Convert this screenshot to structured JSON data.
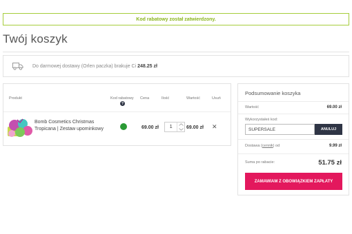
{
  "alert": {
    "message": "Kod rabatowy został zatwierdzony."
  },
  "page": {
    "title": "Twój koszyk"
  },
  "shipping": {
    "icon": "truck-icon",
    "text": "Do darmowej dostawy (Orlen paczka) brakuje Ci",
    "amount": "248.25 zł"
  },
  "cart": {
    "headers": {
      "product": "Produkt",
      "discount_code": "Kod rabatowy",
      "discount_icon": "?",
      "price": "Cena",
      "quantity": "Ilość",
      "value": "Wartość",
      "remove": "Usuń"
    },
    "items": [
      {
        "name": "Bomb Cosmetics Christmas Tropicana | Zestaw upominkowy",
        "discount_applied_color": "#2a9a35",
        "price": "69.00 zł",
        "quantity": "1",
        "value": "69.00 zł",
        "remove_icon": "close-icon"
      }
    ]
  },
  "summary": {
    "title": "Podsumowanie koszyka",
    "value_label": "Wartość",
    "value": "69.00 zł",
    "code_label": "Wykorzystałeś kod:",
    "code_value": "SUPERSALE",
    "cancel_label": "ANULUJ",
    "delivery_label_prefix": "Dostawa (",
    "delivery_link": "cennik",
    "delivery_label_suffix": ") od",
    "delivery_value": "9.99 zł",
    "after_discount_label": "Suma po rabacie:",
    "after_discount_value": "51.75 zł",
    "order_button": "ZAMAWIAM Z OBOWIĄZKIEM ZAPŁATY"
  },
  "colors": {
    "accent_green": "#8ab51e",
    "order_button": "#e3185d",
    "cancel_button": "#2f3545"
  }
}
